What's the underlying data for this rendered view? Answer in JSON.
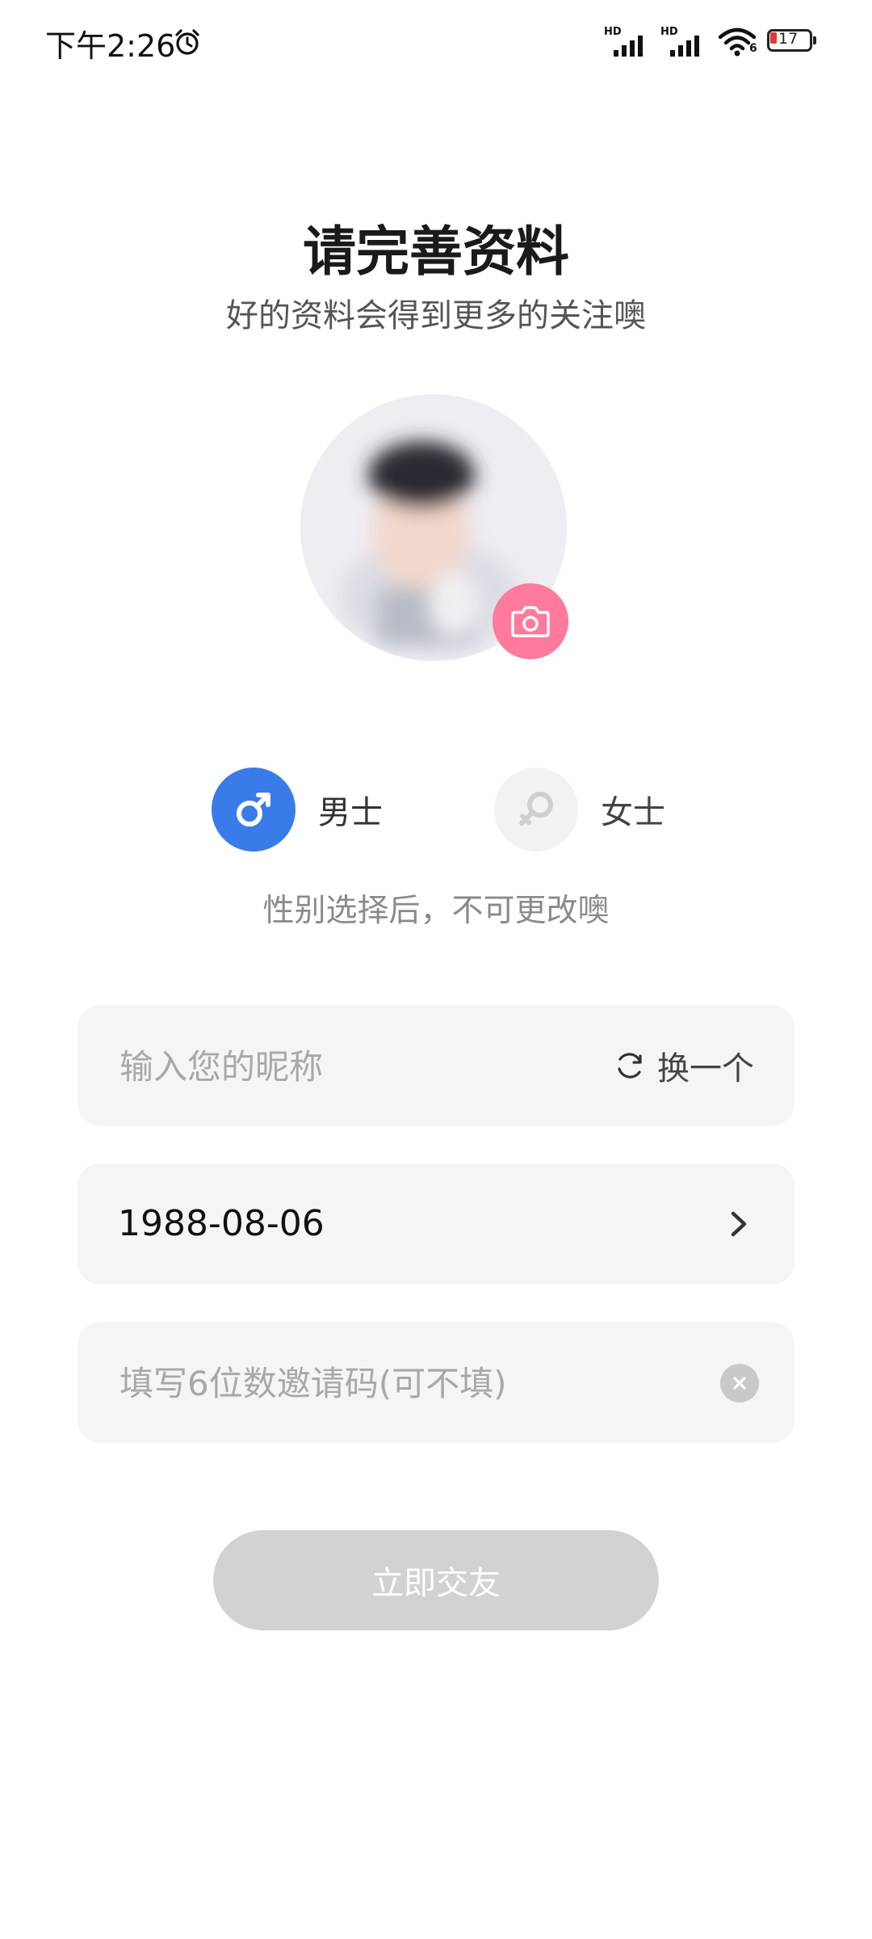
{
  "status_bar": {
    "time": "下午2:26",
    "network_1": "HD",
    "network_2": "HD",
    "wifi_badge": "6",
    "battery": "17",
    "icons": [
      "alarm-icon",
      "signal-icon",
      "wifi-icon",
      "battery-icon"
    ],
    "battery_color": "#e53935"
  },
  "header": {
    "title": "请完善资料",
    "subtitle": "好的资料会得到更多的关注噢"
  },
  "avatar": {
    "camera_icon": "camera-icon",
    "accent": "#ff7a9c"
  },
  "gender": {
    "male_label": "男士",
    "female_label": "女士",
    "selected": "male",
    "male_color": "#3a7bea",
    "note": "性别选择后，不可更改噢"
  },
  "form": {
    "nickname_placeholder": "输入您的昵称",
    "nickname_value": "",
    "refresh_label": "换一个",
    "birthday_value": "1988-08-06",
    "invite_placeholder": "填写6位数邀请码(可不填)",
    "invite_value": ""
  },
  "submit": {
    "label": "立即交友",
    "enabled": false
  }
}
